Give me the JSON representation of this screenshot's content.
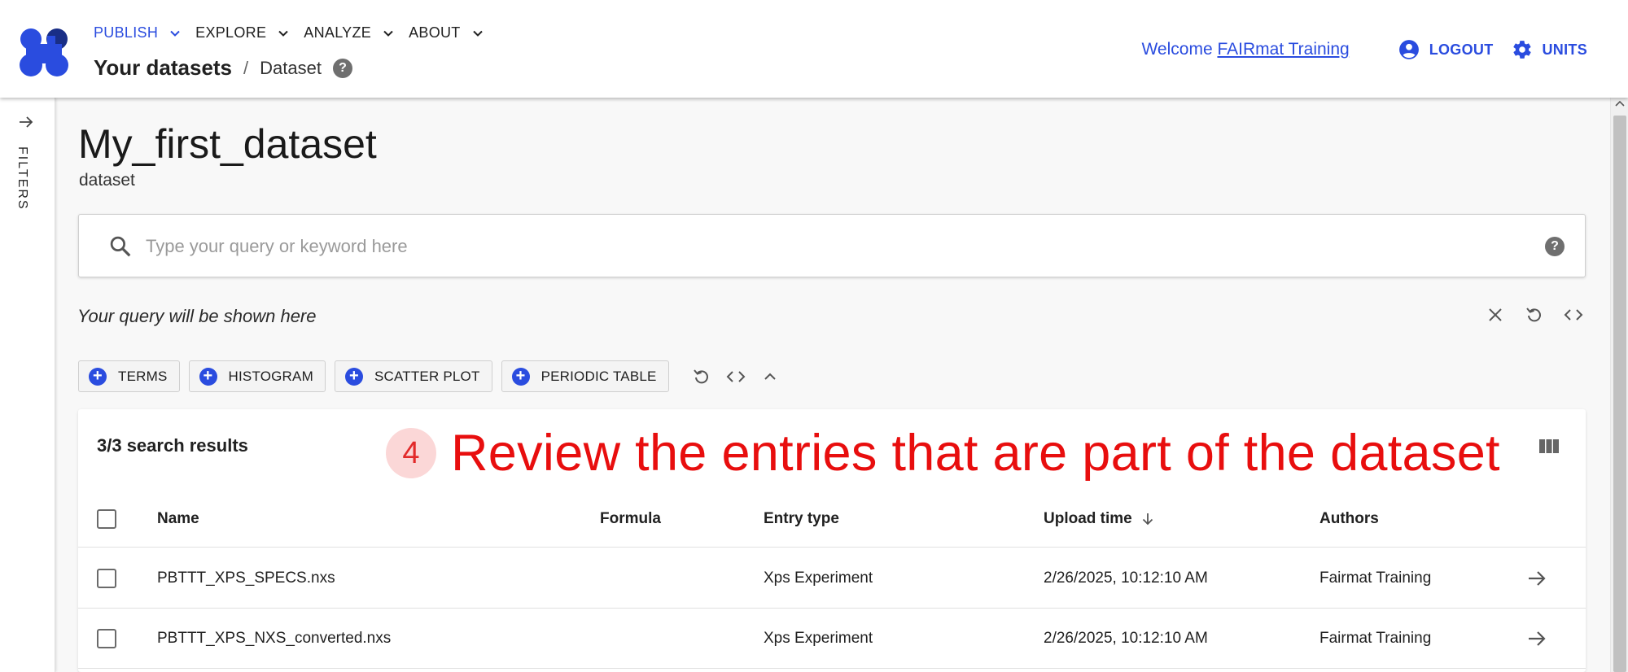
{
  "colors": {
    "accent": "#2a4cdf",
    "annotation": "#e80e0e",
    "annotation_bg": "#fbd7d7"
  },
  "nav": {
    "menu": [
      {
        "label": "PUBLISH",
        "active": true
      },
      {
        "label": "EXPLORE",
        "active": false
      },
      {
        "label": "ANALYZE",
        "active": false
      },
      {
        "label": "ABOUT",
        "active": false
      }
    ],
    "breadcrumb": {
      "parent": "Your datasets",
      "separator": "/",
      "current": "Dataset"
    },
    "welcome_prefix": "Welcome",
    "user_name": "FAIRmat Training",
    "logout_label": "LOGOUT",
    "units_label": "UNITS"
  },
  "sidebar": {
    "label": "FILTERS"
  },
  "dataset": {
    "title": "My_first_dataset",
    "subtitle": "dataset"
  },
  "search": {
    "placeholder": "Type your query or keyword here",
    "query_text": "Your query will be shown here"
  },
  "widgets": [
    "TERMS",
    "HISTOGRAM",
    "SCATTER PLOT",
    "PERIODIC TABLE"
  ],
  "results": {
    "count_label": "3/3 search results",
    "annotation_number": "4",
    "annotation_text": "Review the entries that are part of the dataset",
    "columns": [
      "Name",
      "Formula",
      "Entry type",
      "Upload time",
      "Authors"
    ],
    "rows": [
      {
        "name": "PBTTT_XPS_SPECS.nxs",
        "formula": "",
        "entry_type": "Xps Experiment",
        "upload_time": "2/26/2025, 10:12:10 AM",
        "authors": "Fairmat Training"
      },
      {
        "name": "PBTTT_XPS_NXS_converted.nxs",
        "formula": "",
        "entry_type": "Xps Experiment",
        "upload_time": "2/26/2025, 10:12:10 AM",
        "authors": "Fairmat Training"
      }
    ]
  }
}
